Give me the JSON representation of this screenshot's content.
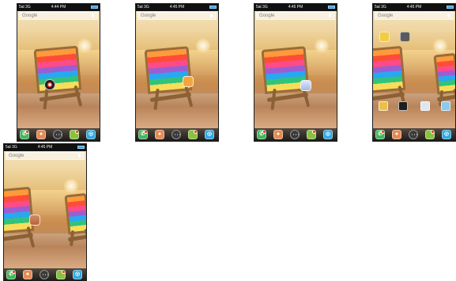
{
  "screens": [
    {
      "status": {
        "signal": "5al 3G",
        "time": "4:44 PM"
      },
      "search": {
        "placeholder": "Google"
      },
      "dock": {
        "items": [
          "phone-icon",
          "contacts-icon",
          "apps-icon",
          "messages-icon",
          "browser-icon"
        ]
      }
    },
    {
      "status": {
        "signal": "5al 3G",
        "time": "4:45 PM"
      },
      "search": {
        "placeholder": "Google"
      },
      "dock": {
        "items": [
          "phone-icon",
          "contacts-icon",
          "apps-icon",
          "messages-icon",
          "browser-icon"
        ]
      }
    },
    {
      "status": {
        "signal": "5al 3G",
        "time": "4:45 PM"
      },
      "search": {
        "placeholder": "Google"
      },
      "dock": {
        "items": [
          "phone-icon",
          "contacts-icon",
          "apps-icon",
          "messages-icon",
          "browser-icon"
        ]
      }
    },
    {
      "status": {
        "signal": "5al 3G",
        "time": "4:45 PM"
      },
      "search": {
        "placeholder": "Google"
      },
      "dock": {
        "items": [
          "phone-icon",
          "contacts-icon",
          "apps-icon",
          "messages-icon",
          "browser-icon"
        ]
      }
    },
    {
      "status": {
        "signal": "5al 3G",
        "time": "4:45 PM"
      },
      "search": {
        "placeholder": "Google"
      },
      "dock": {
        "items": [
          "phone-icon",
          "contacts-icon",
          "apps-icon",
          "messages-icon",
          "browser-icon"
        ]
      }
    }
  ],
  "colors": {
    "battery": "#42a3e6",
    "phone": "#44b65b",
    "contacts": "#e48b55",
    "messages": "#88c240",
    "browser": "#32a7df",
    "badge": "#ff2a2a"
  }
}
